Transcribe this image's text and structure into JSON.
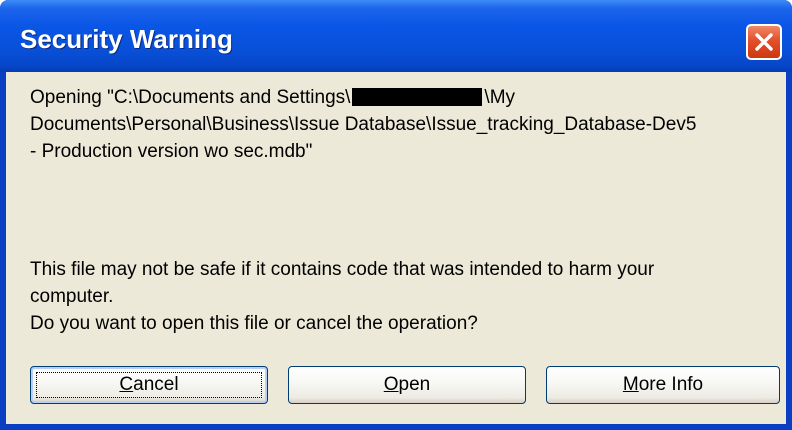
{
  "window": {
    "title": "Security Warning"
  },
  "message": {
    "line1_prefix": "Opening \"C:\\Documents and Settings\\",
    "line1_suffix": "\\My",
    "line2": "Documents\\Personal\\Business\\Issue Database\\Issue_tracking_Database-Dev5",
    "line3": "- Production version wo sec.mdb\""
  },
  "warning": {
    "line1": "This file may not be safe if it contains code that was intended to harm your",
    "line2": "computer.",
    "line3": "Do you want to open this file or cancel the operation?"
  },
  "buttons": {
    "cancel": {
      "accel": "C",
      "rest": "ancel"
    },
    "open": {
      "accel": "O",
      "rest": "pen"
    },
    "more_info": {
      "accel": "M",
      "rest": "ore Info"
    }
  },
  "icons": {
    "close": "close-icon"
  },
  "colors": {
    "titlebar": "#0a56e6",
    "client": "#ece9d8",
    "close_button": "#e2502c"
  }
}
